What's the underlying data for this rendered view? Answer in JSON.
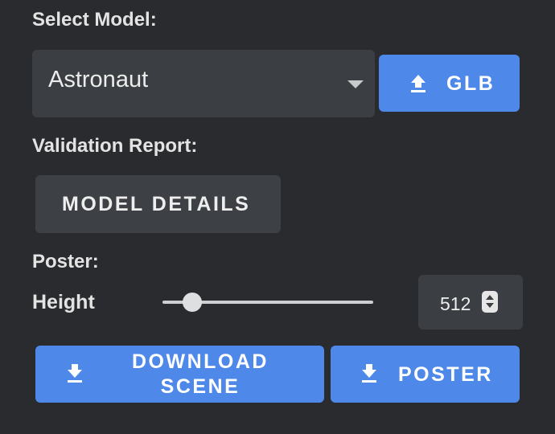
{
  "select_model": {
    "label": "Select Model:",
    "selected_value": "Astronaut",
    "upload_button_label": "GLB",
    "upload_icon": "upload-icon"
  },
  "validation": {
    "label": "Validation Report:",
    "details_button_label": "MODEL DETAILS"
  },
  "poster": {
    "label": "Poster:",
    "height_label": "Height",
    "height_value": "512",
    "height_slider_fraction": 0.14,
    "download_scene_label": "DOWNLOAD SCENE",
    "poster_button_label": "POSTER",
    "download_icon": "download-icon"
  },
  "colors": {
    "background": "#2a2b2e",
    "accent_blue": "#4e89ea",
    "control_grey": "#3b3e42"
  }
}
